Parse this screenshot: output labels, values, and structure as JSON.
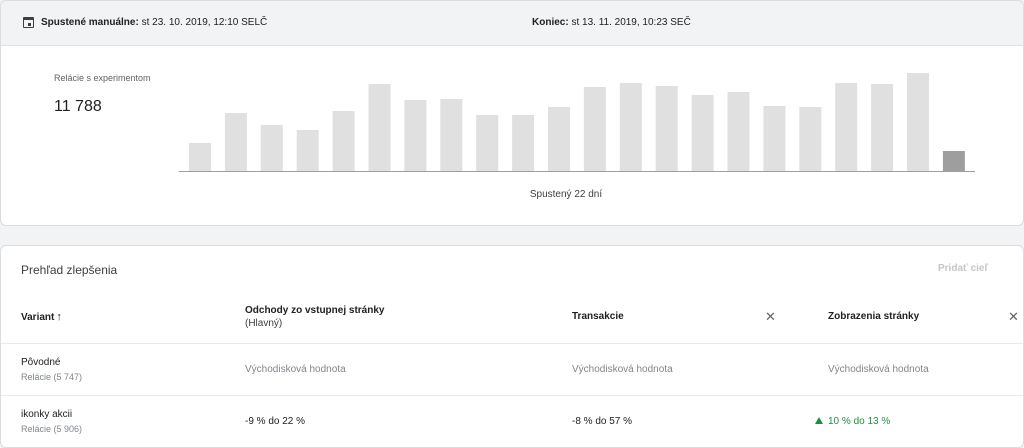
{
  "experiment_info": {
    "start_label": "Spustené manuálne:",
    "start_value": "st 23. 10. 2019, 12:10 SELČ",
    "end_label": "Koniec:",
    "end_value": "st 13. 11. 2019, 10:23 SEČ"
  },
  "metric": {
    "label": "Relácie s experimentom",
    "value": "11 788"
  },
  "chart_data": {
    "type": "bar",
    "caption": "Spustený 22 dní",
    "values": [
      28,
      58,
      46,
      41,
      60,
      87,
      71,
      72,
      56,
      56,
      64,
      84,
      88,
      85,
      76,
      79,
      65,
      64,
      88,
      87,
      98,
      20
    ],
    "highlight_index": 21,
    "bar_color": "#e0e0e0",
    "highlight_color": "#9e9e9e",
    "ylim": [
      0,
      100
    ]
  },
  "overview": {
    "title": "Prehľad zlepšenia",
    "add_goal": "Pridať cieľ",
    "columns": {
      "variant": "Variant",
      "variant_sort_icon": "arrow-up-icon",
      "bounce_title": "Odchody zo vstupnej stránky",
      "bounce_sub": "(Hlavný)",
      "transactions": "Transakcie",
      "pageviews": "Zobrazenia stránky"
    },
    "rows": [
      {
        "name": "Pôvodné",
        "sessions": "Relácie (5 747)",
        "bounce": "Východisková hodnota",
        "transactions": "Východisková hodnota",
        "pageviews": "Východisková hodnota"
      },
      {
        "name": "ikonky akcii",
        "sessions": "Relácie (5 906)",
        "bounce": "-9 % do 22 %",
        "transactions": "-8 % do 57 %",
        "pageviews": "10 % do 13 %"
      }
    ],
    "positive_color": "#1e8e3e"
  }
}
